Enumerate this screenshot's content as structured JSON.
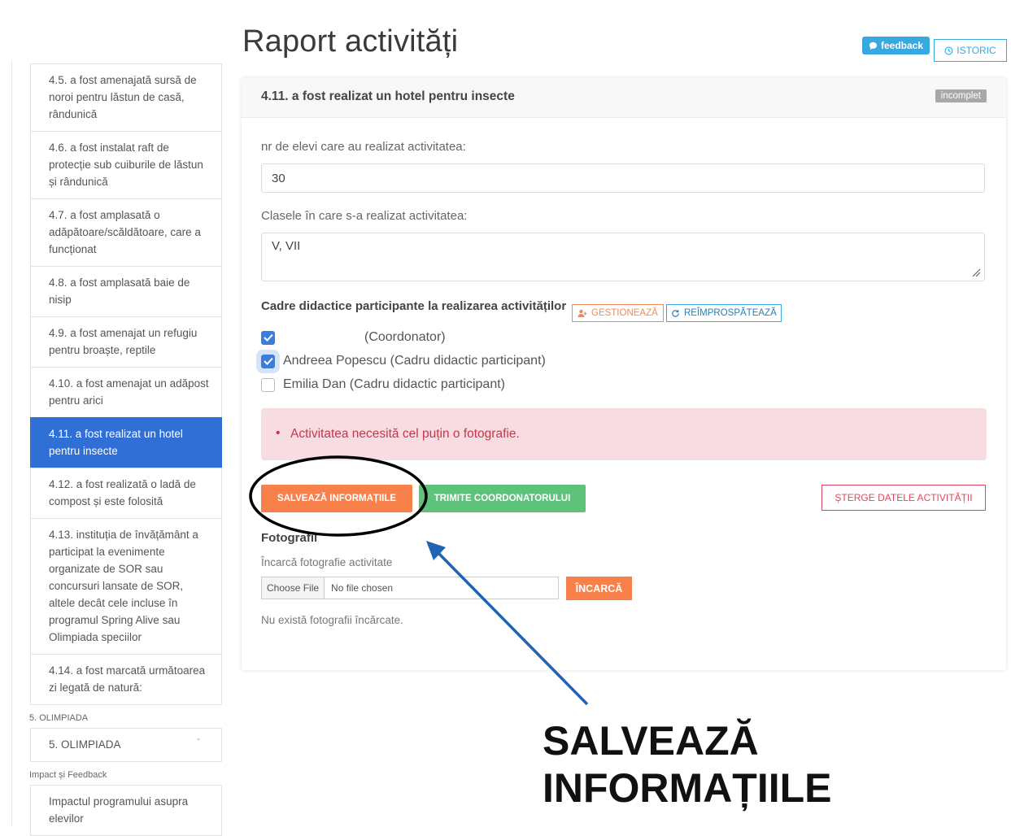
{
  "page": {
    "title": "Raport activități"
  },
  "header": {
    "feedback_label": "feedback",
    "istoric_label": "ISTORIC"
  },
  "sidebar": {
    "items": [
      {
        "label": "4.5. a fost amenajată sursă de noroi pentru lăstun de casă, rândunică",
        "active": false
      },
      {
        "label": "4.6. a fost instalat raft de protecție sub cuiburile de lăstun și rândunică",
        "active": false
      },
      {
        "label": "4.7. a fost amplasată o adăpătoare/scăldătoare, care a funcționat",
        "active": false
      },
      {
        "label": "4.8. a fost amplasată baie de nisip",
        "active": false
      },
      {
        "label": "4.9. a fost amenajat un refugiu pentru broaște, reptile",
        "active": false
      },
      {
        "label": "4.10. a fost amenajat un adăpost pentru arici",
        "active": false
      },
      {
        "label": "4.11. a fost realizat un hotel pentru insecte",
        "active": true
      },
      {
        "label": "4.12. a fost realizată o ladă de compost și este folosită",
        "active": false
      },
      {
        "label": "4.13. instituția de învățământ a participat la evenimente organizate de SOR sau concursuri lansate de SOR, altele decât cele incluse în programul Spring Alive sau Olimpiada speciilor",
        "active": false
      },
      {
        "label": "4.14. a fost marcată următoarea zi legată de natură:",
        "active": false
      }
    ],
    "groups": [
      {
        "label": "5. OLIMPIADA",
        "item": "5. OLIMPIADA",
        "dash": "-"
      },
      {
        "label": "Impact și Feedback",
        "item": "Impactul programului asupra elevilor"
      }
    ]
  },
  "card": {
    "title": "4.11. a fost realizat un hotel pentru insecte",
    "status_badge": "incomplet",
    "students_label": "nr de elevi care au realizat activitatea:",
    "students_value": "30",
    "classes_label": "Clasele în care s-a realizat activitatea:",
    "classes_value": "V, VII",
    "teachers_title": "Cadre didactice participante la realizarea activităților",
    "manage_label": "GESTIONEAZĂ",
    "refresh_label": "REÎMPROSPĂTEAZĂ",
    "teachers": [
      {
        "label": "(Coordonator)",
        "checked": true
      },
      {
        "label": "Andreea Popescu (Cadru didactic participant)",
        "checked": true
      },
      {
        "label": "Emilia Dan (Cadru didactic participant)",
        "checked": false
      }
    ],
    "error": "Activitatea necesită cel puțin o fotografie.",
    "save_label": "SALVEAZĂ INFORMAȚIILE",
    "send_label": "TRIMITE COORDONATORULUI",
    "delete_label": "ȘTERGE DATELE ACTIVITĂȚII",
    "photos_title": "Fotografii",
    "photos_sub": "Încarcă fotografie activitate",
    "choose_file_label": "Choose File",
    "no_file_label": "No file chosen",
    "upload_label": "ÎNCARCĂ",
    "no_photos": "Nu există fotografii încărcate."
  },
  "annotation": {
    "line1": "SALVEAZĂ",
    "line2": "INFORMAȚIILE"
  },
  "colors": {
    "accent_blue": "#2f6fd6",
    "orange": "#f7804b",
    "green": "#5fc27a",
    "red": "#e0475d",
    "info": "#37a9e0",
    "arrow": "#1f64b3"
  }
}
